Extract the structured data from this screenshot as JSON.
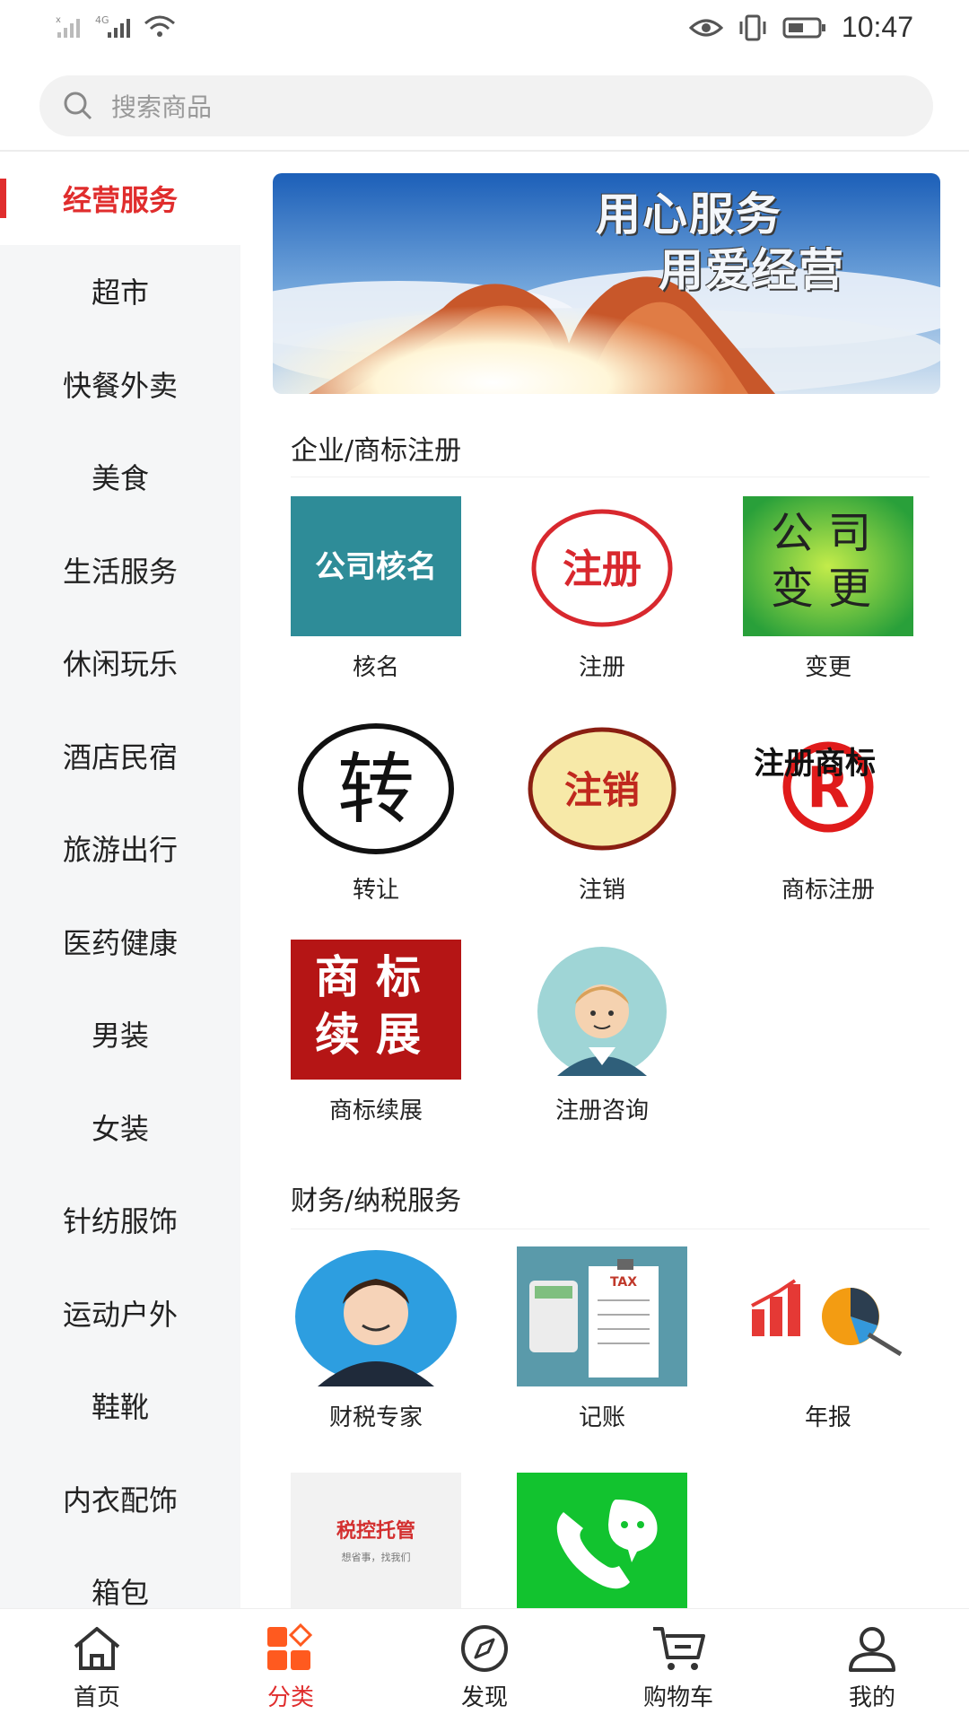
{
  "status_bar": {
    "time": "10:47",
    "signal_label": "4G"
  },
  "search": {
    "placeholder": "搜索商品"
  },
  "sidebar": {
    "items": [
      {
        "label": "经营服务",
        "active": true
      },
      {
        "label": "超市"
      },
      {
        "label": "快餐外卖"
      },
      {
        "label": "美食"
      },
      {
        "label": "生活服务"
      },
      {
        "label": "休闲玩乐"
      },
      {
        "label": "酒店民宿"
      },
      {
        "label": "旅游出行"
      },
      {
        "label": "医药健康"
      },
      {
        "label": "男装"
      },
      {
        "label": "女装"
      },
      {
        "label": "针纺服饰"
      },
      {
        "label": "运动户外"
      },
      {
        "label": "鞋靴"
      },
      {
        "label": "内衣配饰"
      },
      {
        "label": "箱包"
      }
    ]
  },
  "banner": {
    "line1": "用心服务",
    "line2": "用爱经营"
  },
  "sections": [
    {
      "title": "企业/商标注册",
      "tiles": [
        {
          "label": "核名",
          "image_text": "公司核名"
        },
        {
          "label": "注册",
          "image_text": "注册"
        },
        {
          "label": "变更",
          "image_text": "公司变更"
        },
        {
          "label": "转让",
          "image_text": "转"
        },
        {
          "label": "注销",
          "image_text": "注销"
        },
        {
          "label": "商标注册",
          "image_text": "注册商标"
        },
        {
          "label": "商标续展",
          "image_text": "商标续展"
        },
        {
          "label": "注册咨询"
        }
      ]
    },
    {
      "title": "财务/纳税服务",
      "tiles": [
        {
          "label": "财税专家"
        },
        {
          "label": "记账",
          "image_text": "TAX"
        },
        {
          "label": "年报"
        },
        {
          "label": "",
          "image_text": "税控托管",
          "image_subtext": "想省事，找我们"
        },
        {
          "label": ""
        }
      ]
    }
  ],
  "bottom_nav": {
    "items": [
      {
        "label": "首页",
        "icon": "home-icon"
      },
      {
        "label": "分类",
        "icon": "category-icon",
        "active": true
      },
      {
        "label": "发现",
        "icon": "compass-icon"
      },
      {
        "label": "购物车",
        "icon": "cart-icon"
      },
      {
        "label": "我的",
        "icon": "user-icon"
      }
    ]
  },
  "colors": {
    "accent": "#e02d2d",
    "sidebar_bg": "#f5f6f7",
    "active_icon_orange": "#ff5a1f"
  }
}
